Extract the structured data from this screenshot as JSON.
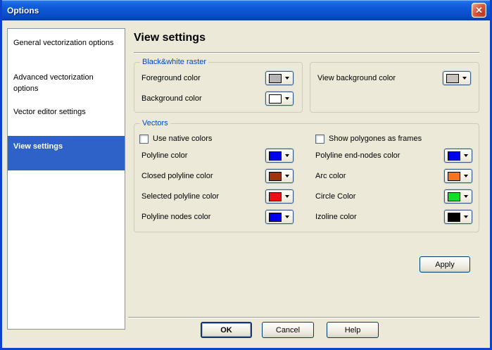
{
  "window": {
    "title": "Options",
    "close_icon": "✕"
  },
  "sidebar": {
    "items": [
      {
        "label": "General vectorization options",
        "selected": false
      },
      {
        "label": "Advanced vectorization options",
        "selected": false
      },
      {
        "label": "Vector editor settings",
        "selected": false
      },
      {
        "label": "View settings",
        "selected": true
      }
    ]
  },
  "main": {
    "heading": "View settings",
    "bw_group": {
      "title": "Black&white raster",
      "rows": [
        {
          "label": "Foreground color",
          "color": "#B5B5B5"
        },
        {
          "label": "Background color",
          "color": "#FFFFFF"
        }
      ]
    },
    "view_group": {
      "rows": [
        {
          "label": "View background color",
          "color": "#C9C3BD"
        }
      ]
    },
    "vectors_group": {
      "title": "Vectors",
      "checkboxes": [
        {
          "label": "Use native colors",
          "checked": false
        },
        {
          "label": "Show polygones as frames",
          "checked": false
        }
      ],
      "left_rows": [
        {
          "label": "Polyline color",
          "color": "#0000EE"
        },
        {
          "label": "Closed polyline color",
          "color": "#A0340C"
        },
        {
          "label": "Selected polyline color",
          "color": "#EE1010"
        },
        {
          "label": "Polyline nodes color",
          "color": "#0000EE"
        }
      ],
      "right_rows": [
        {
          "label": "Polyline end-nodes color",
          "color": "#0000EE"
        },
        {
          "label": "Arc color",
          "color": "#F57421"
        },
        {
          "label": "Circle Color",
          "color": "#12DD2B"
        },
        {
          "label": "Izoline color",
          "color": "#000000"
        }
      ]
    },
    "apply_label": "Apply"
  },
  "footer": {
    "ok": "OK",
    "cancel": "Cancel",
    "help": "Help"
  },
  "colors": {
    "dialog_bg": "#ECE9D8",
    "titlebar_blue": "#0B51CE",
    "window_border": "#0C43CE",
    "selection_highlight": "#2E62C8",
    "group_caption": "#0046D5",
    "close_button_red": "#CC4327"
  }
}
